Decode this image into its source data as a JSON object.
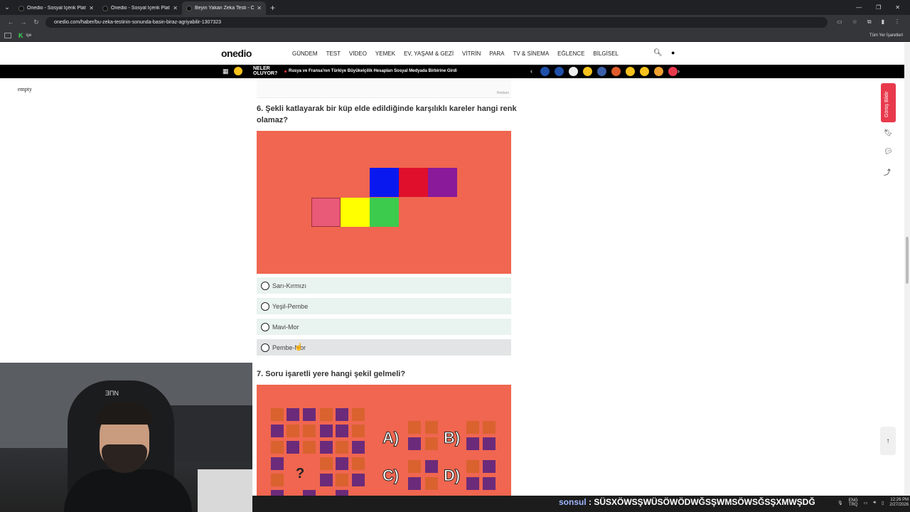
{
  "browser": {
    "tabs": [
      {
        "title": "Onedio - Sosyal İçerik Platform",
        "active": false
      },
      {
        "title": "Onedio - Sosyal İçerik Platform",
        "active": false
      },
      {
        "title": "Beyin Yakan Zeka Testi - Oned",
        "active": true
      }
    ],
    "url": "onedio.com/haber/bu-zeka-testinin-sonunda-basin-biraz-agriyabilir-1307323",
    "bookmark_item": "işe",
    "bookmarks_all": "Tüm Yer İşaretleri"
  },
  "site": {
    "logo": "onedio",
    "menu": [
      "GÜNDEM",
      "TEST",
      "VİDEO",
      "YEMEK",
      "EV, YAŞAM & GEZİ",
      "VİTRİN",
      "PARA",
      "TV & SİNEMA",
      "EĞLENCE",
      "BİLGİSEL"
    ],
    "ticker_label": "NELER OLUYOR?",
    "ticker_headline": "Rusya ve Fransa'nın Türkiye Büyükelçilik Hesapları Sosyal Medyada Birbirine Girdi",
    "emoji_colors": [
      "#1f4fa8",
      "#1f4fa8",
      "#222",
      "#f6c21b",
      "#3b5fa8",
      "#e05b2b",
      "#f6c21b",
      "#f6c21b",
      "#f0a030",
      "#e8394c"
    ]
  },
  "sidebar_left": {
    "label": "empty"
  },
  "ad": {
    "label": "Reklam"
  },
  "question6": {
    "title": "6. Şekli katlayarak bir küp elde edildiğinde karşılıklı kareler hangi renk olamaz?",
    "squares": [
      {
        "color": "#0a18f0"
      },
      {
        "color": "#e0102c"
      },
      {
        "color": "#8a1a9a"
      },
      {
        "color": "#e85a78"
      },
      {
        "color": "#ffff00"
      },
      {
        "color": "#3ccb4c"
      }
    ],
    "options": [
      "Sarı-Kırmızı",
      "Yeşil-Pembe",
      "Mavi-Mor",
      "Pembe-Mor"
    ]
  },
  "question7": {
    "title": "7. Soru işaretli yere hangi şekil gelmeli?",
    "answer_labels": [
      "A)",
      "B)",
      "C)",
      "D)"
    ],
    "question_mark": "?"
  },
  "tools": {
    "report": "Görüş Bildir"
  },
  "chat": {
    "user": "sonsul",
    "message": "SÜSXÖWSŞWÜSÖWÖDWĞSŞWMSÖWSĞSŞXMWŞDĞ"
  },
  "tray": {
    "lang1": "ENG",
    "lang2": "TRQ",
    "time": "12:26 PM",
    "date": "2/27/2026"
  },
  "webcam": {
    "cap_logo": "ƎΠN"
  }
}
